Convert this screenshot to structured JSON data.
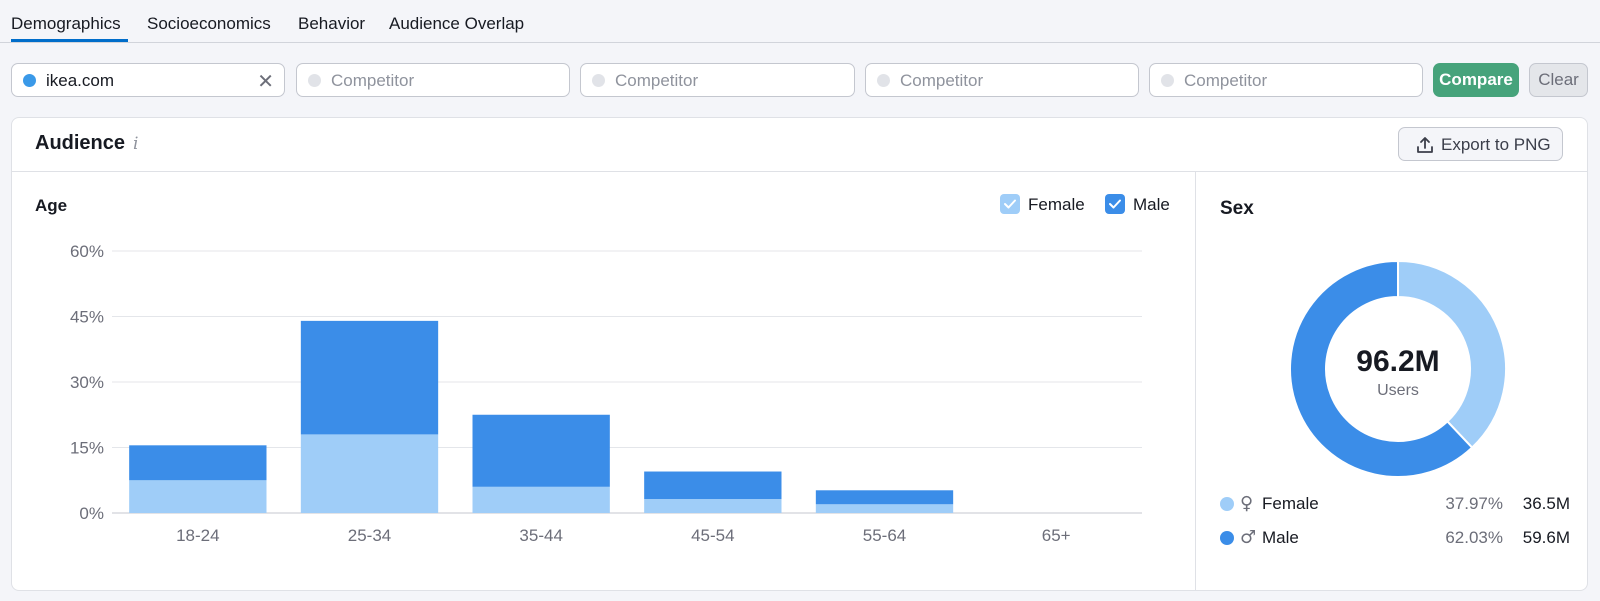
{
  "tabs": [
    {
      "label": "Demographics",
      "active": true
    },
    {
      "label": "Socioeconomics",
      "active": false
    },
    {
      "label": "Behavior",
      "active": false
    },
    {
      "label": "Audience Overlap",
      "active": false
    }
  ],
  "domains": {
    "main_value": "ikea.com",
    "competitor_placeholder": "Competitor",
    "compare_label": "Compare",
    "clear_label": "Clear"
  },
  "audience": {
    "title": "Audience",
    "info_icon": "i",
    "export_label": "Export to PNG"
  },
  "age": {
    "title": "Age",
    "legend": [
      {
        "label": "Female",
        "checked": true,
        "color": "#9fcdf8"
      },
      {
        "label": "Male",
        "checked": true,
        "color": "#3b8de8"
      }
    ]
  },
  "sex": {
    "title": "Sex",
    "total": "96.2M",
    "total_label": "Users",
    "rows": [
      {
        "label": "Female",
        "symbol": "♀",
        "percent": "37.97%",
        "count": "36.5M",
        "color": "#9fcdf8"
      },
      {
        "label": "Male",
        "symbol": "♂",
        "percent": "62.03%",
        "count": "59.6M",
        "color": "#3b8de8"
      }
    ]
  },
  "chart_data": [
    {
      "type": "bar",
      "stacked": true,
      "title": "Age",
      "categories": [
        "18-24",
        "25-34",
        "35-44",
        "45-54",
        "55-64",
        "65+"
      ],
      "series": [
        {
          "name": "Female",
          "color": "#9fcdf8",
          "values": [
            7.5,
            18,
            6,
            3.2,
            2,
            0
          ]
        },
        {
          "name": "Male",
          "color": "#3b8de8",
          "values": [
            8,
            26,
            16.5,
            6.3,
            3.2,
            0
          ]
        }
      ],
      "yticks": [
        "0%",
        "15%",
        "30%",
        "45%",
        "60%"
      ],
      "ylim": [
        0,
        60
      ],
      "grid": true,
      "legend": "top-right"
    },
    {
      "type": "pie",
      "title": "Sex",
      "labels": [
        "Female",
        "Male"
      ],
      "values": [
        37.97,
        62.03
      ],
      "colors": [
        "#9fcdf8",
        "#3b8de8"
      ]
    }
  ]
}
